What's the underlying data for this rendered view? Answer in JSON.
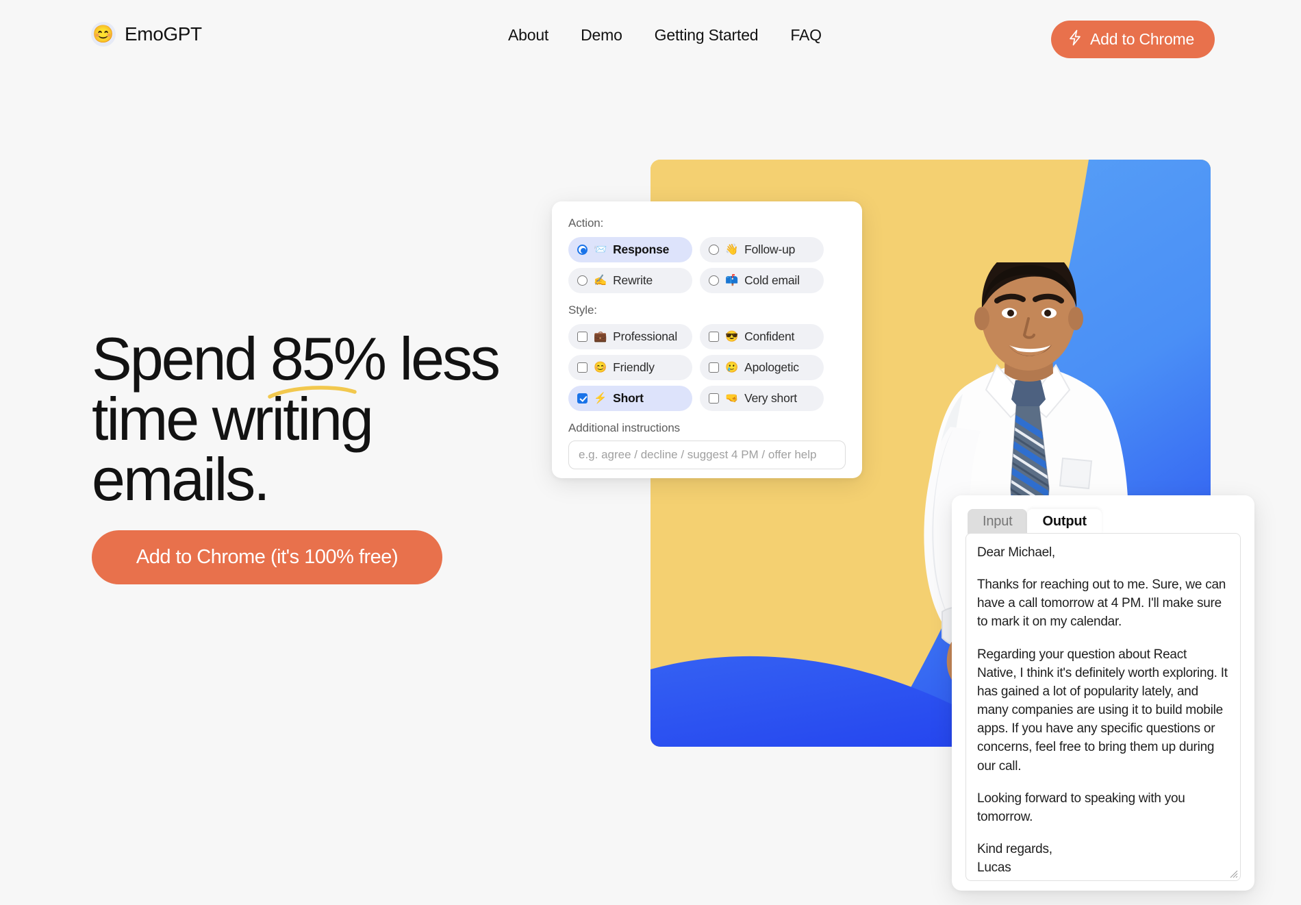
{
  "brand": {
    "logo_emoji": "😊",
    "name": "EmoGPT"
  },
  "nav": {
    "links": [
      {
        "label": "About"
      },
      {
        "label": "Demo"
      },
      {
        "label": "Getting Started"
      },
      {
        "label": "FAQ"
      }
    ],
    "cta_label": "Add to Chrome",
    "cta_icon": "bolt-icon"
  },
  "hero": {
    "headline_line1_a": "Spend ",
    "headline_highlight": "85%",
    "headline_line1_b": " less",
    "headline_line2": "time writing",
    "headline_line3": "emails.",
    "cta_label": "Add to Chrome (it's 100% free)",
    "underline_color": "#f2c84e"
  },
  "settings_card": {
    "action_label": "Action:",
    "action_options": [
      {
        "emoji": "📨",
        "label": "Response",
        "selected": true
      },
      {
        "emoji": "👋",
        "label": "Follow-up",
        "selected": false
      },
      {
        "emoji": "✍️",
        "label": "Rewrite",
        "selected": false
      },
      {
        "emoji": "📫",
        "label": "Cold email",
        "selected": false
      }
    ],
    "style_label": "Style:",
    "style_options": [
      {
        "emoji": "💼",
        "label": "Professional",
        "selected": false
      },
      {
        "emoji": "😎",
        "label": "Confident",
        "selected": false
      },
      {
        "emoji": "😊",
        "label": "Friendly",
        "selected": false
      },
      {
        "emoji": "🥲",
        "label": "Apologetic",
        "selected": false
      },
      {
        "emoji": "⚡",
        "label": "Short",
        "selected": true
      },
      {
        "emoji": "🤜",
        "label": "Very short",
        "selected": false
      }
    ],
    "instructions_label": "Additional instructions",
    "instructions_placeholder": "e.g. agree / decline / suggest 4 PM / offer help",
    "instructions_value": ""
  },
  "output_card": {
    "tabs": [
      {
        "label": "Input",
        "active": false
      },
      {
        "label": "Output",
        "active": true
      }
    ],
    "email": {
      "greeting": "Dear Michael,",
      "paragraph1": "Thanks for reaching out to me. Sure, we can have a call tomorrow at 4 PM. I'll make sure to mark it on my calendar.",
      "paragraph2": "Regarding your question about React Native, I think it's definitely worth exploring. It has gained a lot of popularity lately, and many companies are using it to build mobile apps. If you have any specific questions or concerns, feel free to bring them up during our call.",
      "paragraph3": "Looking forward to speaking with you tomorrow.",
      "signoff": "Kind regards,",
      "signature": "Lucas"
    }
  },
  "colors": {
    "page_bg": "#f7f7f7",
    "accent_orange": "#e8714c",
    "hero_yellow": "#f4d071",
    "hero_blue_light": "#54a0f5",
    "hero_blue_deep": "#2b52f0",
    "selected_chip": "#dde3fb",
    "chip_bg": "#f0f1f5"
  }
}
